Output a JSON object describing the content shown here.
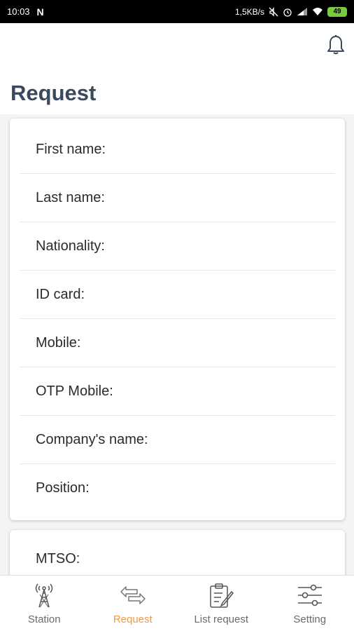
{
  "status_bar": {
    "time": "10:03",
    "net_speed": "1,5KB/s",
    "battery_level": "49",
    "battery_color": "#7ac943"
  },
  "header": {
    "title": "Request",
    "bell_icon": "bell-icon"
  },
  "form": {
    "fields": [
      {
        "label": "First name:"
      },
      {
        "label": "Last name:"
      },
      {
        "label": "Nationality:"
      },
      {
        "label": "ID card:"
      },
      {
        "label": "Mobile:"
      },
      {
        "label": "OTP Mobile:"
      },
      {
        "label": "Company's name:"
      },
      {
        "label": "Position:"
      }
    ],
    "mtso_label": "MTSO:"
  },
  "bottom_nav": {
    "active_color": "#f29a3c",
    "items": [
      {
        "label": "Station",
        "icon": "tower-icon"
      },
      {
        "label": "Request",
        "icon": "arrows-exchange-icon"
      },
      {
        "label": "List request",
        "icon": "clipboard-edit-icon"
      },
      {
        "label": "Setting",
        "icon": "sliders-icon"
      }
    ]
  }
}
